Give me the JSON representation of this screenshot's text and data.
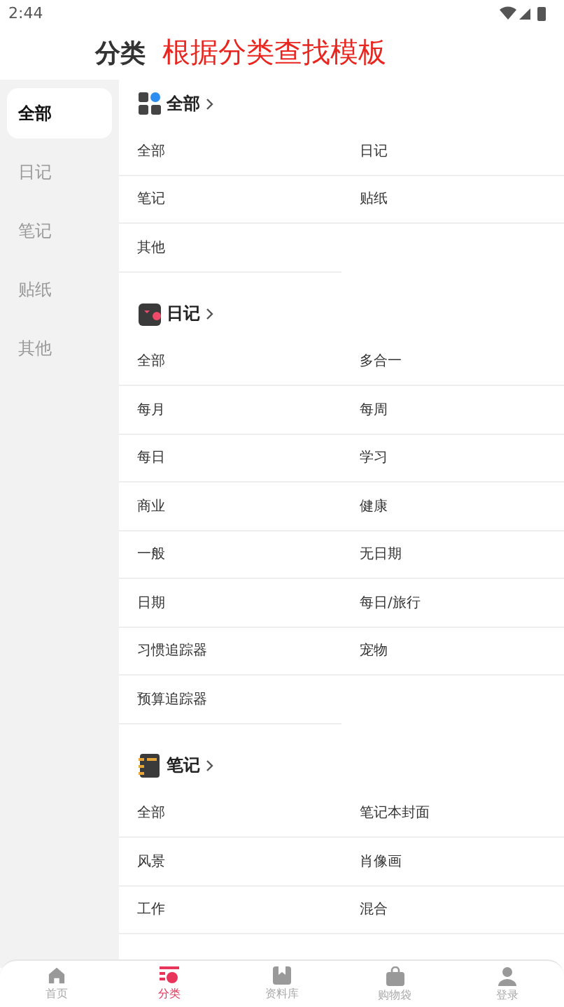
{
  "status_bar": {
    "time": "2:44"
  },
  "header": {
    "title": "分类",
    "subtitle": "根据分类查找模板"
  },
  "sidebar": {
    "items": [
      {
        "label": "全部",
        "selected": true
      },
      {
        "label": "日记",
        "selected": false
      },
      {
        "label": "笔记",
        "selected": false
      },
      {
        "label": "贴纸",
        "selected": false
      },
      {
        "label": "其他",
        "selected": false
      }
    ]
  },
  "sections": [
    {
      "kind": "grid",
      "title": "全部",
      "items": [
        "全部",
        "日记",
        "笔记",
        "贴纸",
        "其他"
      ]
    },
    {
      "kind": "diary",
      "title": "日记",
      "items": [
        "全部",
        "多合一",
        "每月",
        "每周",
        "每日",
        "学习",
        "商业",
        "健康",
        "一般",
        "无日期",
        "日期",
        "每日/旅行",
        "习惯追踪器",
        "宠物",
        "预算追踪器"
      ]
    },
    {
      "kind": "notebook",
      "title": "笔记",
      "items": [
        "全部",
        "笔记本封面",
        "风景",
        "肖像画",
        "工作",
        "混合"
      ]
    }
  ],
  "nav": [
    {
      "kind": "home",
      "label": "首页",
      "selected": false
    },
    {
      "kind": "category",
      "label": "分类",
      "selected": true
    },
    {
      "kind": "book",
      "label": "资料库",
      "selected": false
    },
    {
      "kind": "bag",
      "label": "购物袋",
      "selected": false
    },
    {
      "kind": "person",
      "label": "登录",
      "selected": false
    }
  ]
}
